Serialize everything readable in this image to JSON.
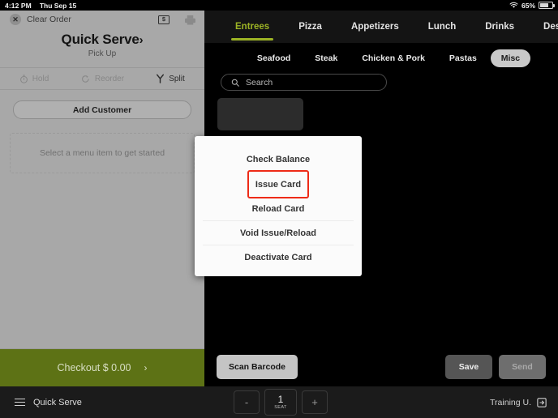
{
  "status_bar": {
    "time": "4:12 PM",
    "date": "Thu Sep 15",
    "battery_percent": "65%",
    "wifi_icon": "wifi-icon",
    "battery_icon": "battery-icon"
  },
  "order_panel": {
    "clear_order_label": "Clear Order",
    "close_icon": "close-icon",
    "cash_icon": "cash-drawer-icon",
    "cash_icon_glyph": "$",
    "print_icon": "printer-icon",
    "title": "Quick Serve",
    "title_chevron": "›",
    "subtitle": "Pick Up",
    "actions": [
      {
        "label": "Hold",
        "icon": "stopwatch-icon",
        "enabled": false
      },
      {
        "label": "Reorder",
        "icon": "refresh-icon",
        "enabled": false
      },
      {
        "label": "Split",
        "icon": "split-icon",
        "enabled": true
      }
    ],
    "add_customer_label": "Add Customer",
    "empty_state": "Select a menu item to get started",
    "checkout_label": "Checkout $ 0.00",
    "checkout_chevron": "›",
    "checkout_color": "#5d7215",
    "footer_label": "Quick Serve",
    "menu_icon": "hamburger-menu-icon"
  },
  "menu_panel": {
    "tabs": [
      {
        "label": "Entrees",
        "active": true
      },
      {
        "label": "Pizza",
        "active": false
      },
      {
        "label": "Appetizers",
        "active": false
      },
      {
        "label": "Lunch",
        "active": false
      },
      {
        "label": "Drinks",
        "active": false
      },
      {
        "label": "Desserts",
        "active": false
      }
    ],
    "active_tab_color": "#9cb325",
    "subtabs": [
      {
        "label": "Seafood",
        "active": false
      },
      {
        "label": "Steak",
        "active": false
      },
      {
        "label": "Chicken & Pork",
        "active": false
      },
      {
        "label": "Pastas",
        "active": false
      },
      {
        "label": "Misc",
        "active": true
      }
    ],
    "search": {
      "placeholder": "Search",
      "value": "",
      "icon": "search-icon"
    },
    "buttons": {
      "scan_barcode": "Scan Barcode",
      "save": "Save",
      "send": "Send"
    },
    "footer": {
      "decrement": "-",
      "seat_number": "1",
      "seat_caption": "SEAT",
      "increment": "+",
      "user_label": "Training U.",
      "exit_icon": "exit-icon"
    }
  },
  "modal": {
    "items": [
      {
        "label": "Check Balance",
        "highlighted": false,
        "separator": false
      },
      {
        "label": "Issue Card",
        "highlighted": true,
        "separator": false
      },
      {
        "label": "Reload Card",
        "highlighted": false,
        "separator": true
      },
      {
        "label": "Void Issue/Reload",
        "highlighted": false,
        "separator": true
      },
      {
        "label": "Deactivate Card",
        "highlighted": false,
        "separator": false
      }
    ],
    "highlight_color": "#ee2b17"
  }
}
